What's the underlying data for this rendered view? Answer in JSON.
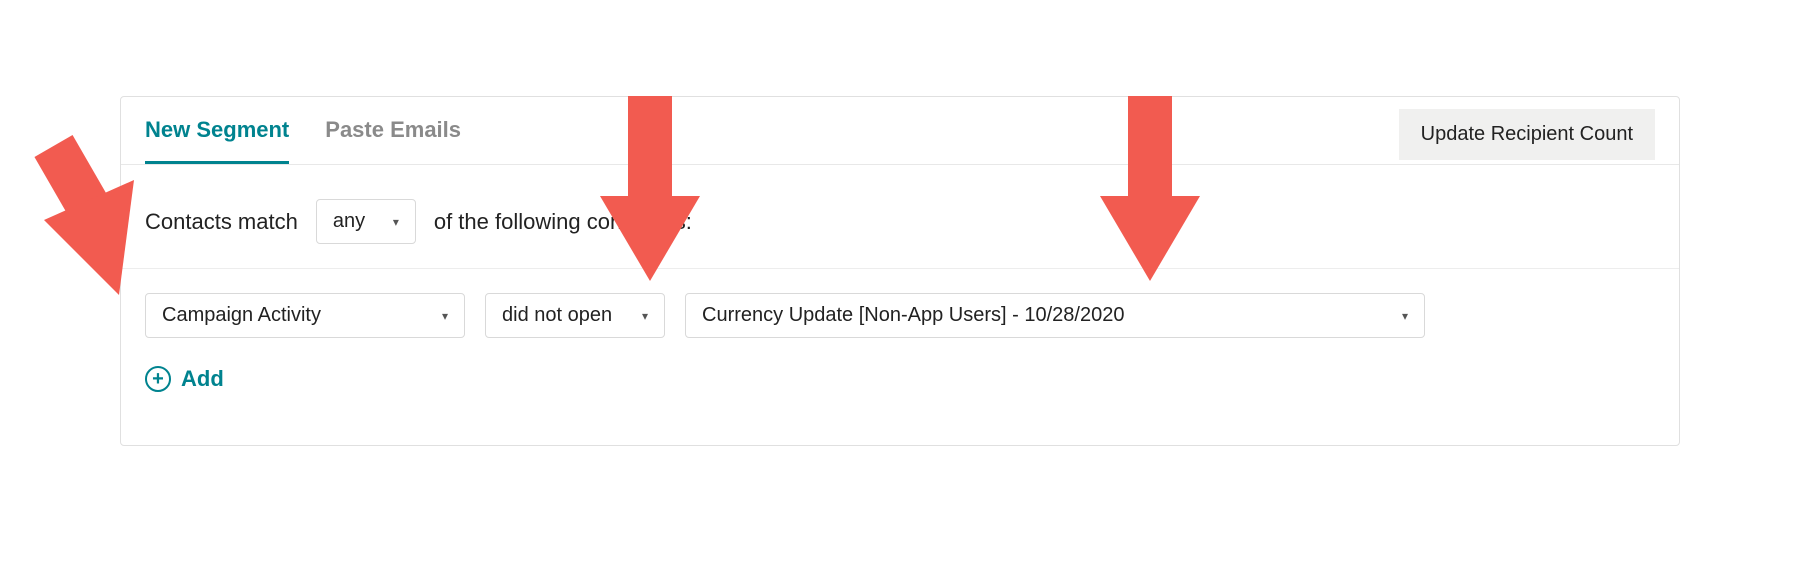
{
  "tabs": {
    "new_segment": "New Segment",
    "paste_emails": "Paste Emails"
  },
  "update_button": "Update Recipient Count",
  "match": {
    "prefix": "Contacts match",
    "operator": "any",
    "suffix": "of the following conditions:"
  },
  "condition": {
    "field": "Campaign Activity",
    "op": "did not open",
    "value": "Currency Update [Non-App Users] - 10/28/2020"
  },
  "add_label": "Add",
  "arrow_color": "#f25b50"
}
